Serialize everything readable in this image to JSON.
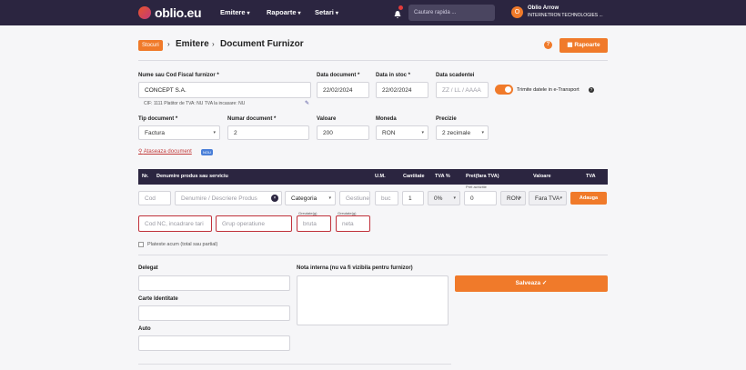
{
  "header": {
    "logo_text": "oblio.eu",
    "nav": [
      {
        "label": "Emitere"
      },
      {
        "label": "Rapoarte"
      },
      {
        "label": "Setari"
      }
    ],
    "search_placeholder": "Cautare rapida ...",
    "user": {
      "initial": "O",
      "name": "Oblio Arrow",
      "company": "INTERNETRON TECHNOLOGIES ..."
    }
  },
  "breadcrumb": {
    "badge": "Stocuri",
    "items": [
      "Emitere",
      "Document Furnizor"
    ]
  },
  "help": "?",
  "reports_button": "Rapoarte",
  "form": {
    "supplier": {
      "label": "Nume sau Cod Fiscal furnizor *",
      "value": "CONCEPT S.A.",
      "details": "CIF: 1111   Platitor de TVA: NU   TVA la incasare: NU"
    },
    "doc_date": {
      "label": "Data document *",
      "value": "22/02/2024"
    },
    "stock_date": {
      "label": "Data in stoc *",
      "value": "22/02/2024"
    },
    "due_date": {
      "label": "Data scadentei",
      "placeholder": "ZZ / LL / AAAA"
    },
    "etransport": {
      "label": "Trimite datele in e-Transport",
      "on": true
    },
    "doc_type": {
      "label": "Tip document *",
      "value": "Factura"
    },
    "doc_number": {
      "label": "Numar document *",
      "value": "2"
    },
    "value": {
      "label": "Valoare",
      "value": "200"
    },
    "currency": {
      "label": "Moneda",
      "value": "RON"
    },
    "precision": {
      "label": "Precizie",
      "value": "2 zecimale"
    },
    "attach": {
      "label": "Ataseaza document",
      "badge": "NOU"
    }
  },
  "table": {
    "headers": [
      "Nr.",
      "Denumire produs sau serviciu",
      "U.M.",
      "Cantitate",
      "TVA %",
      "Pret(fara TVA)",
      "Valoare",
      "TVA"
    ],
    "row": {
      "code_ph": "Cod",
      "name_ph": "Denumire / Descriere Produs",
      "category": "Categoria",
      "mgmt_ph": "Gestiune",
      "um_ph": "buc",
      "qty": "1",
      "vat": "0%",
      "price_label": "Pret achizitie",
      "price": "0",
      "currency": "RON",
      "vat_type": "Fara TVA",
      "add_button": "Adauga",
      "nc_ph": "Cod NC, incadrare tari",
      "group_ph": "Grup operatiune",
      "gross_label": "Greutate(g)",
      "gross_ph": "bruta",
      "net_label": "Greutate(g)",
      "net_ph": "neta"
    },
    "pay_now": "Plateste acum (total sau partial)"
  },
  "bottom": {
    "delegate_label": "Delegat",
    "id_label": "Carte Identitate",
    "car_label": "Auto",
    "note_label": "Nota interna (nu va fi vizibila pentru furnizor)",
    "save_button": "Salveaza"
  }
}
